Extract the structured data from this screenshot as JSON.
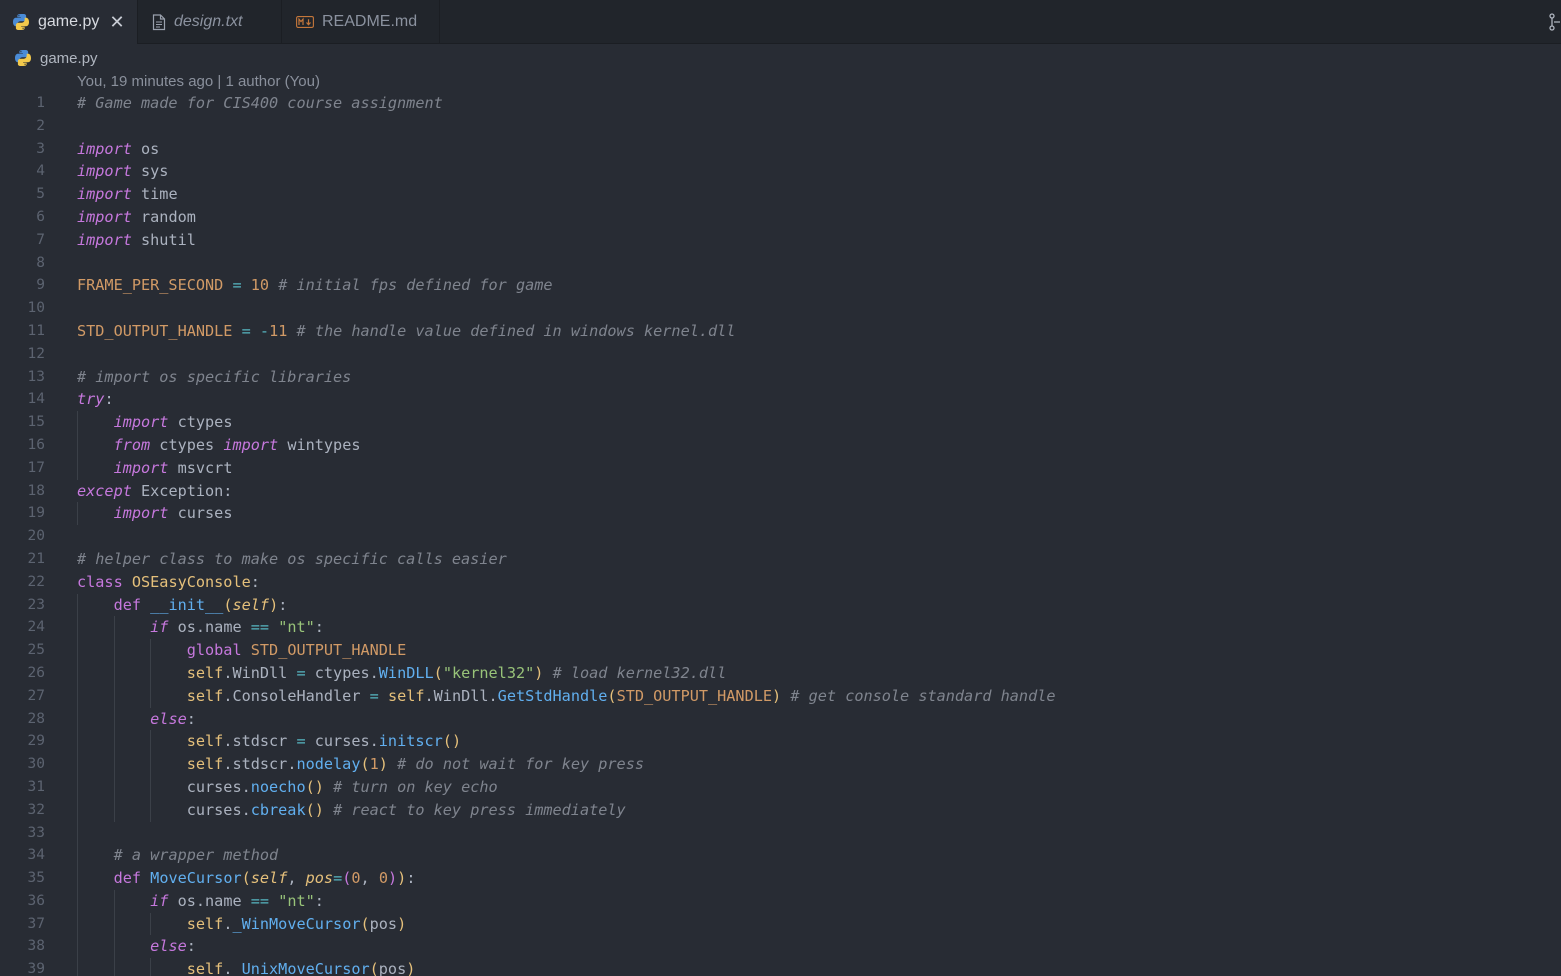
{
  "tabs": [
    {
      "label": "game.py",
      "icon": "python-icon",
      "active": true,
      "close": "✕"
    },
    {
      "label": "design.txt",
      "icon": "text-file-icon",
      "active": false
    },
    {
      "label": "README.md",
      "icon": "markdown-icon",
      "active": false
    }
  ],
  "breadcrumb": {
    "file": "game.py"
  },
  "codelens": {
    "blame": "You, 19 minutes ago | 1 author (You)"
  },
  "colors": {
    "background": "#282c34",
    "tabbar": "#21252b",
    "keyword": "#c678dd",
    "string": "#98c379",
    "function": "#61afef",
    "comment": "#7f848e",
    "constant": "#d19a66",
    "class": "#e5c07b"
  },
  "code": [
    {
      "n": "1",
      "indent": 0,
      "tokens": [
        [
          "cm",
          "# Game made for CIS400 course assignment"
        ]
      ]
    },
    {
      "n": "2",
      "indent": 0,
      "tokens": []
    },
    {
      "n": "3",
      "indent": 0,
      "tokens": [
        [
          "kw",
          "import"
        ],
        [
          "tx",
          " os"
        ]
      ]
    },
    {
      "n": "4",
      "indent": 0,
      "tokens": [
        [
          "kw",
          "import"
        ],
        [
          "tx",
          " sys"
        ]
      ]
    },
    {
      "n": "5",
      "indent": 0,
      "tokens": [
        [
          "kw",
          "import"
        ],
        [
          "tx",
          " time"
        ]
      ]
    },
    {
      "n": "6",
      "indent": 0,
      "tokens": [
        [
          "kw",
          "import"
        ],
        [
          "tx",
          " random"
        ]
      ]
    },
    {
      "n": "7",
      "indent": 0,
      "tokens": [
        [
          "kw",
          "import"
        ],
        [
          "tx",
          " shutil"
        ]
      ]
    },
    {
      "n": "8",
      "indent": 0,
      "tokens": []
    },
    {
      "n": "9",
      "indent": 0,
      "tokens": [
        [
          "cn",
          "FRAME_PER_SECOND"
        ],
        [
          "tx",
          " "
        ],
        [
          "op",
          "="
        ],
        [
          "tx",
          " "
        ],
        [
          "nm",
          "10"
        ],
        [
          "tx",
          " "
        ],
        [
          "cm",
          "# initial fps defined for game"
        ]
      ]
    },
    {
      "n": "10",
      "indent": 0,
      "tokens": []
    },
    {
      "n": "11",
      "indent": 0,
      "tokens": [
        [
          "cn",
          "STD_OUTPUT_HANDLE"
        ],
        [
          "tx",
          " "
        ],
        [
          "op",
          "="
        ],
        [
          "tx",
          " "
        ],
        [
          "op",
          "-"
        ],
        [
          "nm",
          "11"
        ],
        [
          "tx",
          " "
        ],
        [
          "cm",
          "# the handle value defined in windows kernel.dll"
        ]
      ]
    },
    {
      "n": "12",
      "indent": 0,
      "tokens": []
    },
    {
      "n": "13",
      "indent": 0,
      "tokens": [
        [
          "cm",
          "# import os specific libraries"
        ]
      ]
    },
    {
      "n": "14",
      "indent": 0,
      "tokens": [
        [
          "kw",
          "try"
        ],
        [
          "tx",
          ":"
        ]
      ]
    },
    {
      "n": "15",
      "indent": 1,
      "tokens": [
        [
          "tx",
          "    "
        ],
        [
          "kw",
          "import"
        ],
        [
          "tx",
          " ctypes"
        ]
      ]
    },
    {
      "n": "16",
      "indent": 1,
      "tokens": [
        [
          "tx",
          "    "
        ],
        [
          "kw",
          "from"
        ],
        [
          "tx",
          " ctypes "
        ],
        [
          "kw",
          "import"
        ],
        [
          "tx",
          " wintypes"
        ]
      ]
    },
    {
      "n": "17",
      "indent": 1,
      "tokens": [
        [
          "tx",
          "    "
        ],
        [
          "kw",
          "import"
        ],
        [
          "tx",
          " msvcrt"
        ]
      ]
    },
    {
      "n": "18",
      "indent": 0,
      "tokens": [
        [
          "kw",
          "except"
        ],
        [
          "tx",
          " Exception:"
        ]
      ]
    },
    {
      "n": "19",
      "indent": 1,
      "tokens": [
        [
          "tx",
          "    "
        ],
        [
          "kw",
          "import"
        ],
        [
          "tx",
          " curses"
        ]
      ]
    },
    {
      "n": "20",
      "indent": 0,
      "tokens": []
    },
    {
      "n": "21",
      "indent": 0,
      "tokens": [
        [
          "cm",
          "# helper class to make os specific calls easier"
        ]
      ]
    },
    {
      "n": "22",
      "indent": 0,
      "tokens": [
        [
          "kd",
          "class"
        ],
        [
          "tx",
          " "
        ],
        [
          "cl",
          "OSEasyConsole"
        ],
        [
          "tx",
          ":"
        ]
      ]
    },
    {
      "n": "23",
      "indent": 1,
      "tokens": [
        [
          "tx",
          "    "
        ],
        [
          "kd",
          "def"
        ],
        [
          "tx",
          " "
        ],
        [
          "mg",
          "__init__"
        ],
        [
          "br",
          "("
        ],
        [
          "pa",
          "self"
        ],
        [
          "br",
          ")"
        ],
        [
          "tx",
          ":"
        ]
      ]
    },
    {
      "n": "24",
      "indent": 2,
      "tokens": [
        [
          "tx",
          "        "
        ],
        [
          "kw",
          "if"
        ],
        [
          "tx",
          " os.name "
        ],
        [
          "op",
          "=="
        ],
        [
          "tx",
          " "
        ],
        [
          "st",
          "\"nt\""
        ],
        [
          "tx",
          ":"
        ]
      ]
    },
    {
      "n": "25",
      "indent": 3,
      "tokens": [
        [
          "tx",
          "            "
        ],
        [
          "kd",
          "global"
        ],
        [
          "tx",
          " "
        ],
        [
          "cn",
          "STD_OUTPUT_HANDLE"
        ]
      ]
    },
    {
      "n": "26",
      "indent": 3,
      "tokens": [
        [
          "tx",
          "            "
        ],
        [
          "sf",
          "self"
        ],
        [
          "tx",
          ".WinDll "
        ],
        [
          "op",
          "="
        ],
        [
          "tx",
          " ctypes."
        ],
        [
          "fn",
          "WinDLL"
        ],
        [
          "br",
          "("
        ],
        [
          "st",
          "\"kernel32\""
        ],
        [
          "br",
          ")"
        ],
        [
          "tx",
          " "
        ],
        [
          "cm",
          "# load kernel32.dll"
        ]
      ]
    },
    {
      "n": "27",
      "indent": 3,
      "tokens": [
        [
          "tx",
          "            "
        ],
        [
          "sf",
          "self"
        ],
        [
          "tx",
          ".ConsoleHandler "
        ],
        [
          "op",
          "="
        ],
        [
          "tx",
          " "
        ],
        [
          "sf",
          "self"
        ],
        [
          "tx",
          ".WinDll."
        ],
        [
          "fn",
          "GetStdHandle"
        ],
        [
          "br",
          "("
        ],
        [
          "cn",
          "STD_OUTPUT_HANDLE"
        ],
        [
          "br",
          ")"
        ],
        [
          "tx",
          " "
        ],
        [
          "cm",
          "# get console standard handle"
        ]
      ]
    },
    {
      "n": "28",
      "indent": 2,
      "tokens": [
        [
          "tx",
          "        "
        ],
        [
          "kw",
          "else"
        ],
        [
          "tx",
          ":"
        ]
      ]
    },
    {
      "n": "29",
      "indent": 3,
      "tokens": [
        [
          "tx",
          "            "
        ],
        [
          "sf",
          "self"
        ],
        [
          "tx",
          ".stdscr "
        ],
        [
          "op",
          "="
        ],
        [
          "tx",
          " curses."
        ],
        [
          "fn",
          "initscr"
        ],
        [
          "br",
          "()"
        ]
      ]
    },
    {
      "n": "30",
      "indent": 3,
      "tokens": [
        [
          "tx",
          "            "
        ],
        [
          "sf",
          "self"
        ],
        [
          "tx",
          ".stdscr."
        ],
        [
          "fn",
          "nodelay"
        ],
        [
          "br",
          "("
        ],
        [
          "nm",
          "1"
        ],
        [
          "br",
          ")"
        ],
        [
          "tx",
          " "
        ],
        [
          "cm",
          "# do not wait for key press"
        ]
      ]
    },
    {
      "n": "31",
      "indent": 3,
      "tokens": [
        [
          "tx",
          "            curses."
        ],
        [
          "fn",
          "noecho"
        ],
        [
          "br",
          "()"
        ],
        [
          "tx",
          " "
        ],
        [
          "cm",
          "# turn on key echo"
        ]
      ]
    },
    {
      "n": "32",
      "indent": 3,
      "tokens": [
        [
          "tx",
          "            curses."
        ],
        [
          "fn",
          "cbreak"
        ],
        [
          "br",
          "()"
        ],
        [
          "tx",
          " "
        ],
        [
          "cm",
          "# react to key press immediately"
        ]
      ]
    },
    {
      "n": "33",
      "indent": 1,
      "tokens": []
    },
    {
      "n": "34",
      "indent": 1,
      "tokens": [
        [
          "tx",
          "    "
        ],
        [
          "cm",
          "# a wrapper method"
        ]
      ]
    },
    {
      "n": "35",
      "indent": 1,
      "tokens": [
        [
          "tx",
          "    "
        ],
        [
          "kd",
          "def"
        ],
        [
          "tx",
          " "
        ],
        [
          "fn",
          "MoveCursor"
        ],
        [
          "br",
          "("
        ],
        [
          "pa",
          "self"
        ],
        [
          "tx",
          ", "
        ],
        [
          "pa",
          "pos"
        ],
        [
          "op",
          "="
        ],
        [
          "bp",
          "("
        ],
        [
          "nm",
          "0"
        ],
        [
          "tx",
          ", "
        ],
        [
          "nm",
          "0"
        ],
        [
          "bp",
          ")"
        ],
        [
          "br",
          ")"
        ],
        [
          "tx",
          ":"
        ]
      ]
    },
    {
      "n": "36",
      "indent": 2,
      "tokens": [
        [
          "tx",
          "        "
        ],
        [
          "kw",
          "if"
        ],
        [
          "tx",
          " os.name "
        ],
        [
          "op",
          "=="
        ],
        [
          "tx",
          " "
        ],
        [
          "st",
          "\"nt\""
        ],
        [
          "tx",
          ":"
        ]
      ]
    },
    {
      "n": "37",
      "indent": 3,
      "tokens": [
        [
          "tx",
          "            "
        ],
        [
          "sf",
          "self"
        ],
        [
          "tx",
          "."
        ],
        [
          "fn",
          "_WinMoveCursor"
        ],
        [
          "br",
          "("
        ],
        [
          "tx",
          "pos"
        ],
        [
          "br",
          ")"
        ]
      ]
    },
    {
      "n": "38",
      "indent": 2,
      "tokens": [
        [
          "tx",
          "        "
        ],
        [
          "kw",
          "else"
        ],
        [
          "tx",
          ":"
        ]
      ]
    },
    {
      "n": "39",
      "indent": 3,
      "tokens": [
        [
          "tx",
          "            "
        ],
        [
          "sf",
          "self"
        ],
        [
          "tx",
          "."
        ],
        [
          "fn",
          "_UnixMoveCursor"
        ],
        [
          "br",
          "("
        ],
        [
          "tx",
          "pos"
        ],
        [
          "br",
          ")"
        ]
      ]
    }
  ]
}
